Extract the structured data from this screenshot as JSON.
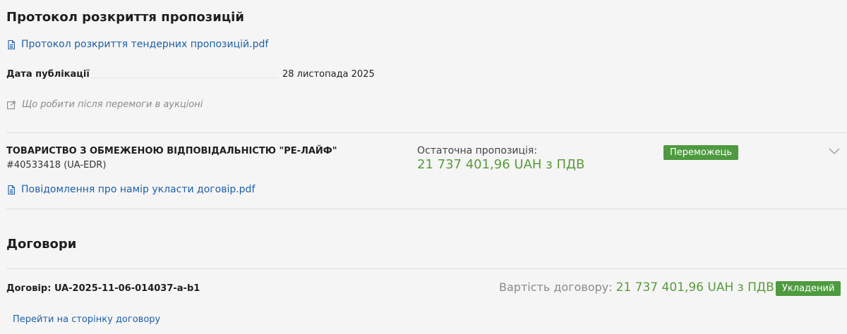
{
  "protocol": {
    "heading": "Протокол розкриття пропозицій",
    "file_link": "Протокол розкриття тендерних пропозицій.pdf",
    "publication_label": "Дата публікації",
    "publication_date": "28 листопада 2025",
    "after_win_link": "Що робити після перемоги в аукціоні"
  },
  "bidder": {
    "name": "ТОВАРИСТВО З ОБМЕЖЕНОЮ ВІДПОВІДАЛЬНІСТЮ \"РЕ-ЛАЙФ\"",
    "edr": "#40533418 (UA-EDR)",
    "final_offer_label": "Остаточна пропозиція:",
    "final_offer_value": "21 737 401,96 UAH з ПДВ",
    "status_badge": "Переможець",
    "file_link": "Повідомлення про намір укласти договір.pdf"
  },
  "contracts": {
    "heading": "Договори",
    "contract_title": "Договір: UA-2025-11-06-014037-a-b1",
    "value_label": "Вартість договору:",
    "value": "21 737 401,96 UAH з ПДВ",
    "status_badge": "Укладений",
    "go_link": "Перейти на сторінку договору"
  },
  "colors": {
    "link": "#1d5fa8",
    "green_text": "#5a9a3c",
    "badge_bg": "#4e9a3f",
    "background": "#f5f5f5"
  },
  "icons": [
    "file-icon",
    "external-link-icon",
    "chevron-down-icon"
  ]
}
